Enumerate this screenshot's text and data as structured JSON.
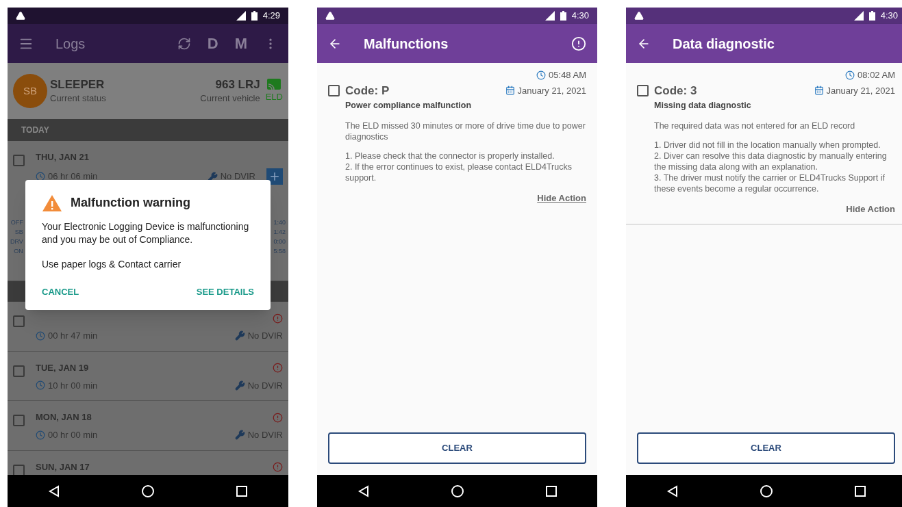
{
  "screens": [
    {
      "kind": "logs",
      "status_time": "4:29",
      "title": "Logs",
      "actions": [
        "D",
        "M"
      ],
      "profile": {
        "initials": "SB",
        "status": "SLEEPER",
        "status_label": "Current status",
        "vehicle": "963 LRJ",
        "vehicle_label": "Current vehicle",
        "eld": "ELD"
      },
      "today_header": "TODAY",
      "days": [
        {
          "date": "THU, JAN 21",
          "duration": "06 hr 06 min",
          "dvir": "No DVIR",
          "checked": false,
          "error": false,
          "add": true,
          "summary": [
            {
              "label": "OFF",
              "value": "1:40"
            },
            {
              "label": "SB",
              "value": "1:42"
            },
            {
              "label": "DRV",
              "value": "0:00"
            },
            {
              "label": "ON",
              "value": "5:58"
            }
          ]
        },
        {
          "duration": "00 hr 47 min",
          "dvir": "No DVIR",
          "checked": false,
          "error": true,
          "add": false
        },
        {
          "date": "TUE, JAN 19",
          "duration": "10 hr 00 min",
          "dvir": "No DVIR",
          "checked": false,
          "error": true,
          "add": false
        },
        {
          "date": "MON, JAN 18",
          "duration": "00 hr 00 min",
          "dvir": "No DVIR",
          "checked": false,
          "error": true,
          "add": false
        },
        {
          "date": "SUN, JAN 17",
          "checked": false,
          "error": true,
          "add": false
        }
      ],
      "dialog": {
        "title": "Malfunction warning",
        "message": "Your Electronic Logging Device is malfunctioning and you may be out of Compliance.",
        "advice": "Use paper logs & Contact carrier",
        "buttons": [
          "CANCEL",
          "SEE DETAILS"
        ]
      }
    },
    {
      "kind": "detail",
      "status_time": "4:30",
      "title": "Malfunctions",
      "alert_action": true,
      "card": {
        "time": "05:48 AM",
        "date": "January 21, 2021",
        "code": "Code: P",
        "checked": false,
        "name": "Power compliance malfunction",
        "description": "The ELD missed 30 minutes or more of drive time due to power diagnostics",
        "steps": [
          "1. Please check that the connector is properly installed.",
          "2. If the error continues to exist, please contact ELD4Trucks support."
        ],
        "link": "Hide Action",
        "underlined": true
      },
      "button": "CLEAR"
    },
    {
      "kind": "detail",
      "status_time": "4:30",
      "title": "Data diagnostic",
      "alert_action": false,
      "card": {
        "time": "08:02 AM",
        "date": "January 21, 2021",
        "code": "Code: 3",
        "checked": false,
        "name": "Missing data diagnostic",
        "description": "The required data was not entered for an ELD record",
        "steps": [
          "1. Driver did not fill in the location manually when prompted.",
          "2. Diver can resolve this data diagnostic by manually entering the missing data along with an explanation.",
          "3. The driver must notify the carrier or ELD4Trucks Support if these events become a regular occurrence."
        ],
        "link": "Hide Action",
        "underlined": false,
        "divider": true
      },
      "button": "CLEAR"
    }
  ]
}
